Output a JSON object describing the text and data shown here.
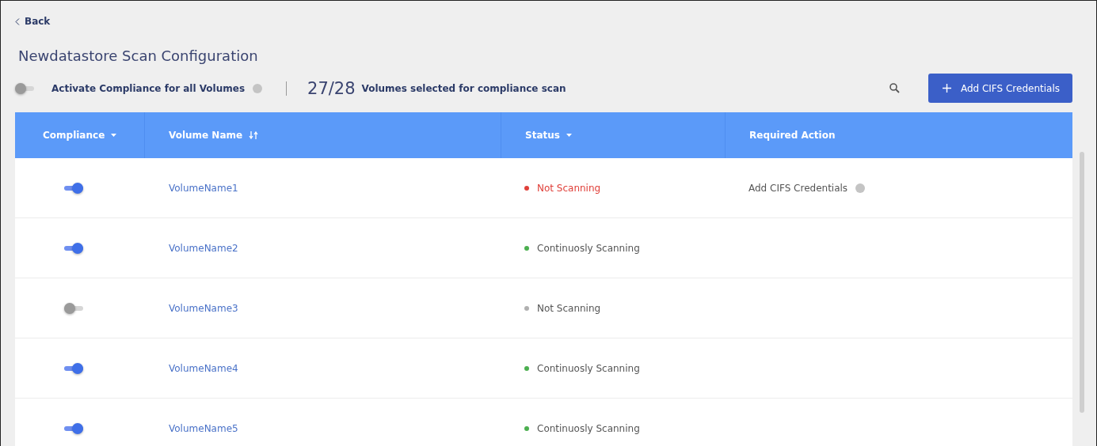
{
  "back": {
    "label": "Back"
  },
  "title": "Newdatastore Scan Configuration",
  "activate_all": {
    "label": "Activate Compliance for  all Volumes",
    "on": false
  },
  "selection": {
    "count": "27/28",
    "label": "Volumes selected for compliance scan"
  },
  "add_button": {
    "label": "Add CIFS Credentials"
  },
  "table": {
    "columns": [
      {
        "label": "Compliance",
        "kind": "dropdown"
      },
      {
        "label": "Volume Name",
        "kind": "sortable"
      },
      {
        "label": "Status",
        "kind": "dropdown"
      },
      {
        "label": "Required Action",
        "kind": "plain"
      }
    ],
    "rows": [
      {
        "on": true,
        "name": "VolumeName1",
        "status": "Not Scanning",
        "color": "#e0403a",
        "action": "Add CIFS Credentials"
      },
      {
        "on": true,
        "name": "VolumeName2",
        "status": "Continuosly Scanning",
        "color": "#4caf50"
      },
      {
        "on": false,
        "name": "VolumeName3",
        "status": "Not Scanning",
        "color": "#b0b0b0"
      },
      {
        "on": true,
        "name": "VolumeName4",
        "status": "Continuosly Scanning",
        "color": "#4caf50"
      },
      {
        "on": true,
        "name": "VolumeName5",
        "status": "Continuosly Scanning",
        "color": "#4caf50"
      }
    ]
  }
}
